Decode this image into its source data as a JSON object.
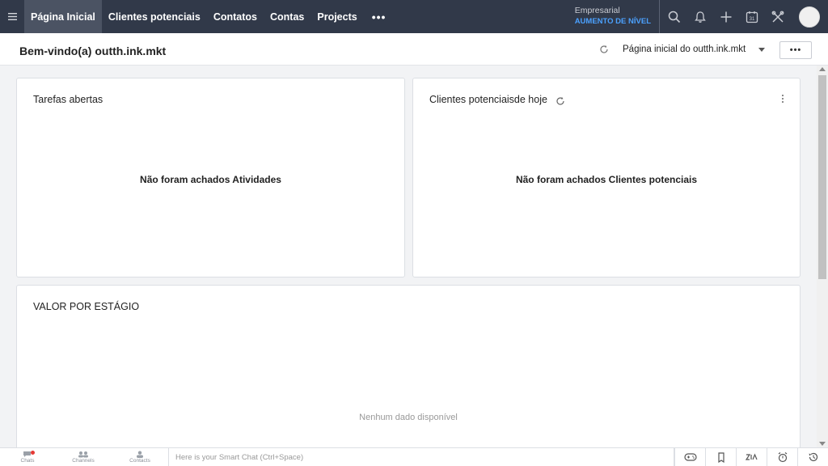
{
  "nav": {
    "tabs": [
      "Página Inicial",
      "Clientes potenciais",
      "Contatos",
      "Contas",
      "Projects"
    ],
    "more": "•••",
    "edition": "Empresarial",
    "upgrade": "AUMENTO DE NÍVEL",
    "icons": [
      "search-icon",
      "bell-icon",
      "plus-icon",
      "calendar-icon",
      "tools-icon"
    ],
    "calendar_day": "31"
  },
  "subheader": {
    "welcome": "Bem-vindo(a) outth.ink.mkt",
    "home_select": "Página inicial do outth.ink.mkt",
    "more": "•••"
  },
  "cards": {
    "tasks": {
      "title": "Tarefas abertas",
      "empty": "Não foram achados Atividades"
    },
    "leads": {
      "title": "Clientes potenciaisde hoje",
      "empty": "Não foram achados Clientes potenciais"
    },
    "stage": {
      "title": "VALOR POR ESTÁGIO",
      "empty": "Nenhum dado disponível"
    }
  },
  "bottombar": {
    "items": [
      {
        "label": "Chats",
        "icon": "chat-icon"
      },
      {
        "label": "Channels",
        "icon": "channels-icon"
      },
      {
        "label": "Contacts",
        "icon": "contact-icon"
      }
    ],
    "smartchat_placeholder": "Here is your Smart Chat (Ctrl+Space)",
    "right_icons": [
      "gamepad-icon",
      "notes-icon",
      "zia-icon",
      "alarm-icon",
      "history-icon"
    ]
  },
  "colors": {
    "topbar": "#313949",
    "active_tab": "#4b5363",
    "upgrade": "#4ba1ff"
  }
}
